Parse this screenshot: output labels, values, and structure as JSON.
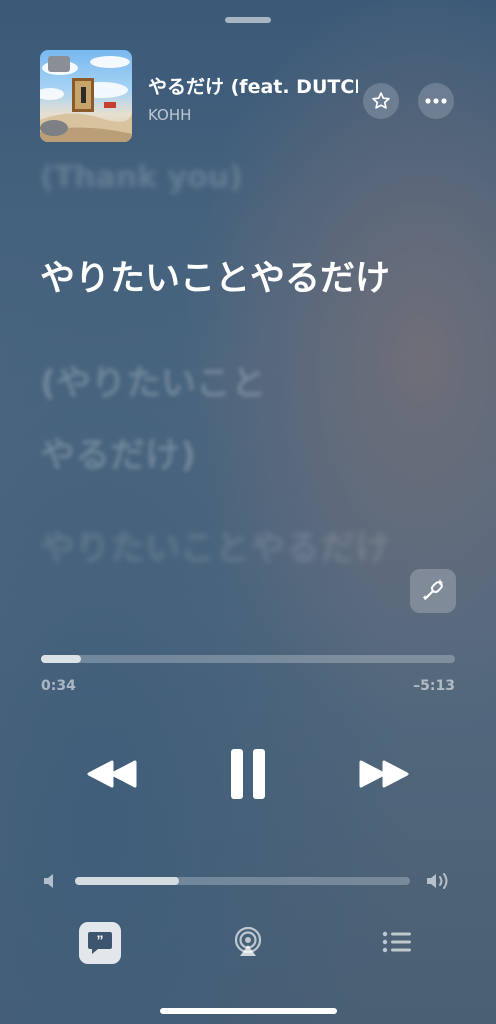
{
  "now_playing": {
    "title": "やるだけ (feat. DUTCHMONTANA)",
    "artist": "KOHH"
  },
  "lyrics": {
    "previous": "(Thank you)",
    "current": "やりたいことやるだけ",
    "next_line1": "(やりたいこと",
    "next_line2": "やるだけ)",
    "following": "やりたいことやるだけ"
  },
  "playback": {
    "elapsed": "0:34",
    "remaining": "–5:13",
    "progress_fraction": 0.097,
    "state": "playing"
  },
  "volume": {
    "level_fraction": 0.31
  },
  "icons": {
    "favorite": "star-icon",
    "more": "ellipsis-icon",
    "sing": "microphone-sparkle-icon",
    "previous": "backward-icon",
    "pause": "pause-icon",
    "next": "forward-icon",
    "volume_low": "speaker-icon",
    "volume_high": "speaker-wave-icon",
    "lyrics": "quote-bubble-icon",
    "airplay": "airplay-icon",
    "queue": "list-icon"
  }
}
